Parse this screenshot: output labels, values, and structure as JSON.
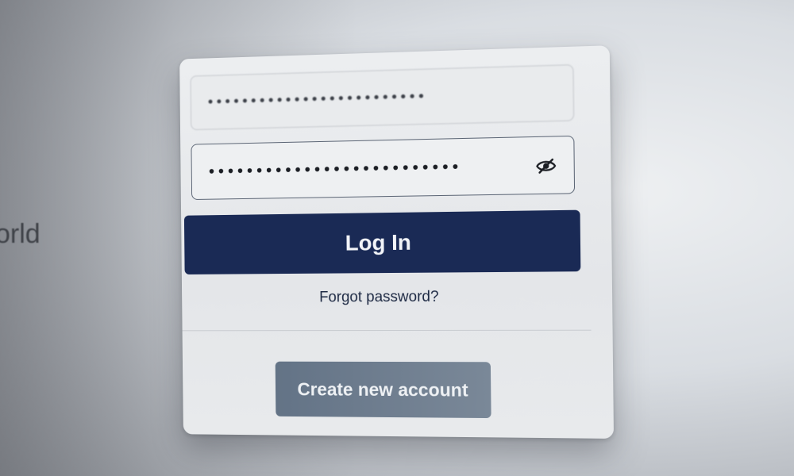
{
  "background": {
    "partial_text": "orld"
  },
  "login_form": {
    "email_field": {
      "value": "•••••••••••••••••••••••••"
    },
    "password_field": {
      "value": "••••••••••••••••••••••••••",
      "toggle_icon": "eye-slash-icon"
    },
    "login_button": {
      "label": "Log In",
      "color": "#1a2a55"
    },
    "forgot_password": {
      "label": "Forgot password?"
    },
    "create_account_button": {
      "label": "Create new account",
      "color": "#6b7a8c"
    }
  }
}
